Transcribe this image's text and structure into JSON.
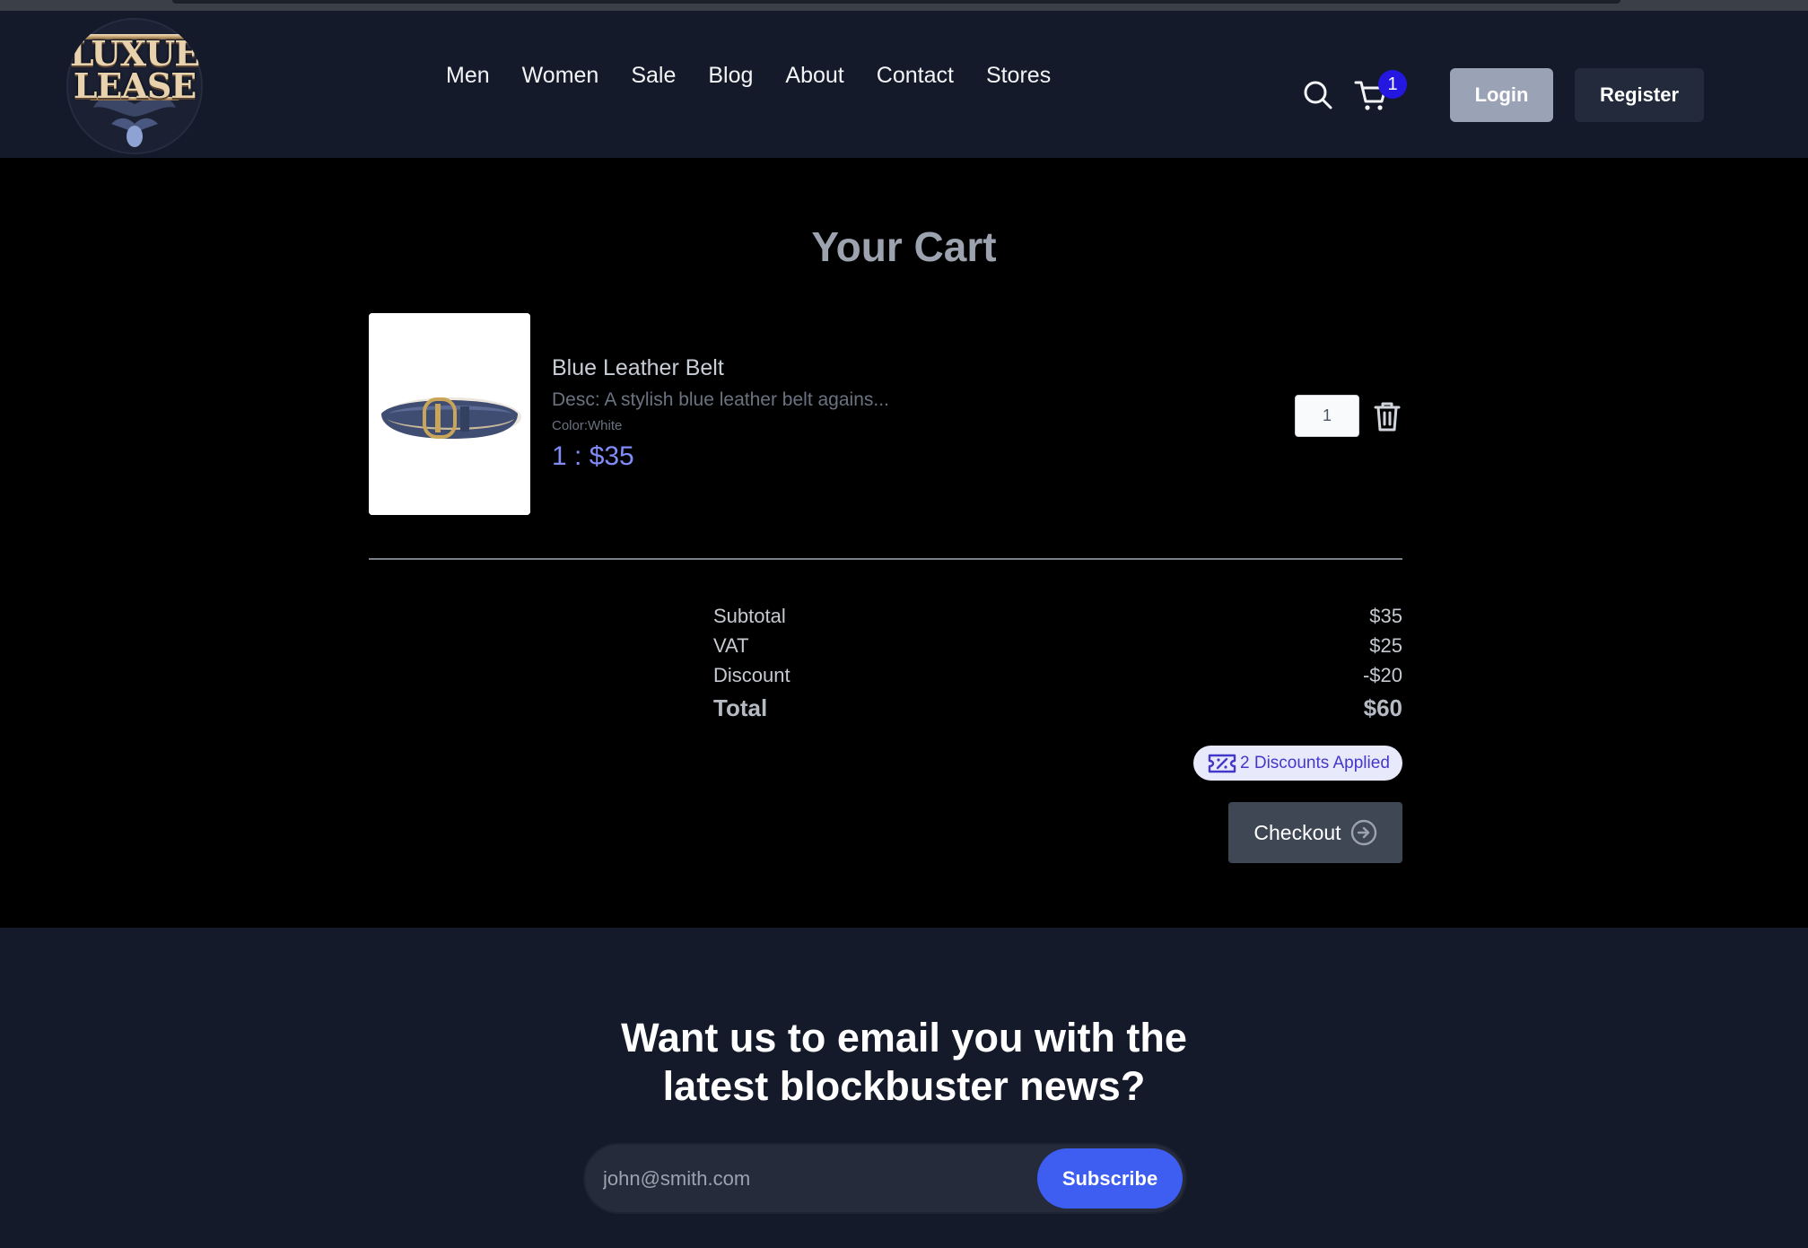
{
  "brand": {
    "logo_text_line1": "LUXUE",
    "logo_text_line2": "LEASE"
  },
  "nav": {
    "links": [
      {
        "label": "Men"
      },
      {
        "label": "Women"
      },
      {
        "label": "Sale"
      },
      {
        "label": "Blog"
      },
      {
        "label": "About"
      },
      {
        "label": "Contact"
      },
      {
        "label": "Stores"
      }
    ],
    "icons": {
      "search": "search-icon",
      "cart": "cart-icon"
    },
    "cart_count": "1",
    "login_label": "Login",
    "register_label": "Register"
  },
  "cart": {
    "title": "Your Cart",
    "items": [
      {
        "name": "Blue Leather Belt",
        "desc": "Desc:  A stylish blue leather belt agains...",
        "color": "Color:White",
        "qty_price": "1 : $35",
        "quantity": "1"
      }
    ],
    "summary": {
      "subtotal_label": "Subtotal",
      "subtotal_value": "$35",
      "vat_label": "VAT",
      "vat_value": "$25",
      "discount_label": "Discount",
      "discount_value": "-$20",
      "total_label": "Total",
      "total_value": "$60"
    },
    "discount_badge": "2 Discounts Applied",
    "checkout_label": "Checkout"
  },
  "newsletter": {
    "heading_line1": "Want us to email you with the",
    "heading_line2": "latest blockbuster news?",
    "email_placeholder": "john@smith.com",
    "subscribe_label": "Subscribe"
  },
  "colors": {
    "header_bg": "#151a2a",
    "cart_bg": "#000000",
    "accent_price": "#818cf8",
    "cart_badge": "#2418e0",
    "subscribe_button": "#3d5ef0"
  }
}
